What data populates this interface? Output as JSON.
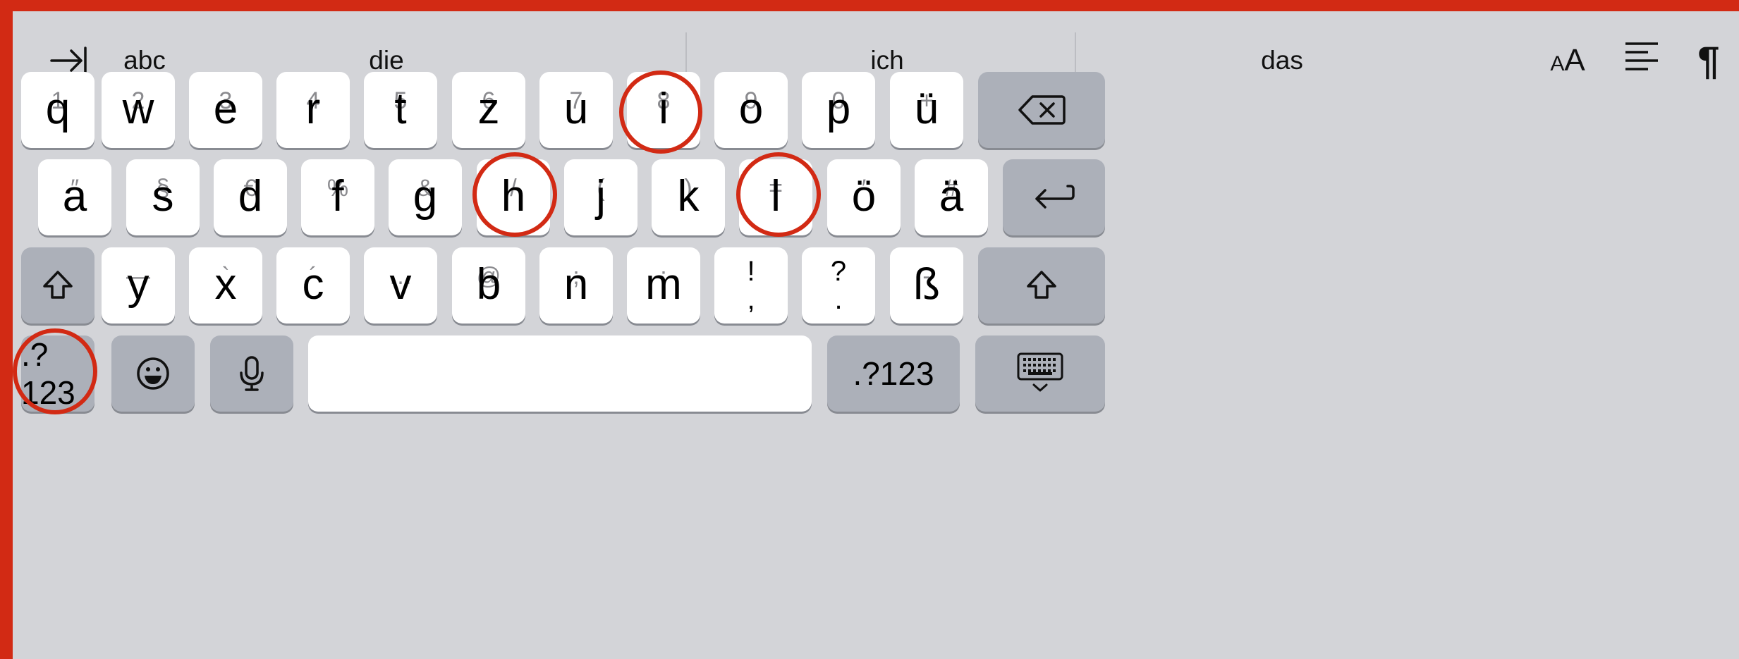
{
  "suggestion_bar": {
    "tab_icon": "tab-arrow-icon",
    "mode_label": "abc",
    "suggestions": [
      "die",
      "ich",
      "das"
    ],
    "font_size_label": "AA",
    "font_size_icon": "text-size-icon",
    "align_icon": "text-align-icon",
    "paragraph_icon": "paragraph-icon",
    "paragraph_glyph": "¶"
  },
  "row1": [
    {
      "sub": "1",
      "main": "q"
    },
    {
      "sub": "2",
      "main": "w"
    },
    {
      "sub": "3",
      "main": "e"
    },
    {
      "sub": "4",
      "main": "r"
    },
    {
      "sub": "5",
      "main": "t"
    },
    {
      "sub": "6",
      "main": "z"
    },
    {
      "sub": "7",
      "main": "u"
    },
    {
      "sub": "8",
      "main": "i"
    },
    {
      "sub": "9",
      "main": "o"
    },
    {
      "sub": "0",
      "main": "p"
    },
    {
      "sub": "+",
      "main": "ü"
    }
  ],
  "row2": [
    {
      "sub": "″",
      "main": "a"
    },
    {
      "sub": "§",
      "main": "s"
    },
    {
      "sub": "€",
      "main": "d"
    },
    {
      "sub": "%",
      "main": "f"
    },
    {
      "sub": "&",
      "main": "g"
    },
    {
      "sub": "/",
      "main": "h"
    },
    {
      "sub": "(",
      "main": "j"
    },
    {
      "sub": ")",
      "main": "k"
    },
    {
      "sub": "=",
      "main": "l"
    },
    {
      "sub": "′",
      "main": "ö"
    },
    {
      "sub": "#",
      "main": "ä"
    }
  ],
  "row3": [
    {
      "sub": "—",
      "main": "y"
    },
    {
      "sub": "`",
      "main": "x"
    },
    {
      "sub": "´",
      "main": "c"
    },
    {
      "sub": "…",
      "main": "v"
    },
    {
      "sub": "@",
      "main": "b"
    },
    {
      "sub": ";",
      "main": "n"
    },
    {
      "sub": ":",
      "main": "m"
    },
    {
      "top": "!",
      "bottom": ","
    },
    {
      "top": "?",
      "bottom": "."
    },
    {
      "sub": "-",
      "main": "ß"
    }
  ],
  "special_keys": {
    "backspace_icon": "backspace-icon",
    "return_icon": "return-icon",
    "shift_icon": "shift-icon",
    "numbers_label": ".?123",
    "emoji_icon": "emoji-icon",
    "mic_icon": "microphone-icon",
    "space_label": "",
    "hide_keyboard_icon": "hide-keyboard-icon"
  },
  "highlighted_keys": [
    "i",
    "h",
    "l",
    ".?123"
  ],
  "colors": {
    "highlight": "#d22a14",
    "keyboard_background": "#d3d4d8",
    "letter_key": "#ffffff",
    "function_key": "#acb0b9"
  }
}
